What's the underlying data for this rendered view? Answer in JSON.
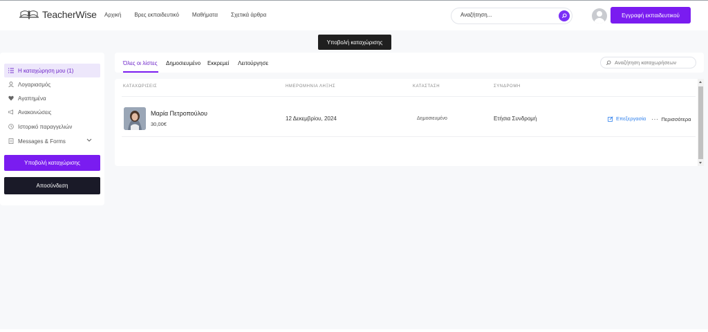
{
  "header": {
    "logo_text": "TeacherWise",
    "nav": [
      "Αρχική",
      "Βρες εκπαιδευτικό",
      "Μαθήματα",
      "Σχετικά άρθρα"
    ],
    "search_placeholder": "Αναζήτηση...",
    "register_button": "Εγγραφή εκπαιδευτικού",
    "accent": "#7a1cf0"
  },
  "tooltip": "Υποβολή καταχώρισης",
  "sidebar": {
    "items": [
      {
        "label": "Η καταχώρηση μου (1)",
        "icon": "list-icon",
        "active": true
      },
      {
        "label": "Λογαριασμός",
        "icon": "user-icon"
      },
      {
        "label": "Αγαπημένα",
        "icon": "heart-icon"
      },
      {
        "label": "Ανακοινώσεις",
        "icon": "megaphone-icon"
      },
      {
        "label": "Ιστορικό παραγγελιών",
        "icon": "clock-icon"
      },
      {
        "label": "Messages & Forms",
        "icon": "document-icon"
      }
    ],
    "submit_button": "Υποβολή καταχώρισης",
    "logout_button": "Αποσύνδεση"
  },
  "tabs": {
    "items": [
      "Όλες οι λίστες",
      "Δημοσιευμένο",
      "Εκκρεμεί",
      "Λειτούργησε"
    ],
    "active_index": 0,
    "search_placeholder": "Αναζήτηση καταχωρήσεων"
  },
  "table": {
    "headers": [
      "ΚΑΤΑΧΩΡΙΣΕΙΣ",
      "ΗΜΕΡΟΜΗΝΙΑ ΛΗΞΗΣ",
      "ΚΑΤΑΣΤΑΣΗ",
      "ΣΥΝΔΡΟΜΗ"
    ],
    "rows": [
      {
        "name": "Μαρία Πετροπούλου",
        "price": "30,00€",
        "expiry": "12 Δεκεμβρίου, 2024",
        "status": "Δημοσιευμένο",
        "subscription": "Ετήσια Συνδρομή",
        "edit": "Επεξεργασία",
        "more": "Περισσότερα"
      }
    ]
  }
}
